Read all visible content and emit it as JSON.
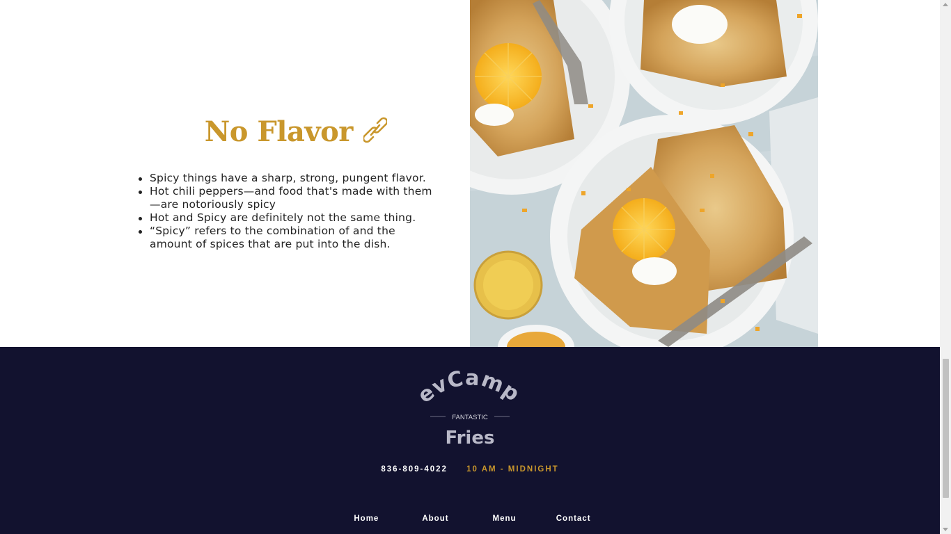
{
  "section": {
    "heading": "No Flavor",
    "bullets": [
      "Spicy things have a sharp, strong, pungent flavor.",
      "Hot chili peppers—and food that's made with them—are notoriously spicy",
      "Hot and Spicy are definitely not the same thing.",
      "“Spicy” refers to the combination of and the amount of spices that are put into the dish."
    ],
    "heading_icon": "link-icon",
    "photo": "crepes-with-orange-and-cream"
  },
  "footer": {
    "logo": {
      "line1": "DevCamp's",
      "line2": "FANTASTIC",
      "line3": "Fries"
    },
    "phone": "836-809-4022",
    "hours": "10 AM - MIDNIGHT",
    "nav": [
      "Home",
      "About",
      "Menu",
      "Contact"
    ]
  },
  "colors": {
    "accent": "#c9972c",
    "footer_bg": "#12122f",
    "text": "#222222"
  }
}
